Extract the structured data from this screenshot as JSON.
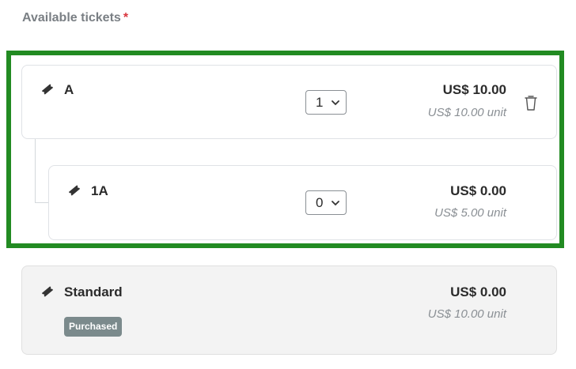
{
  "section": {
    "label": "Available tickets",
    "required_marker": "*"
  },
  "tickets": [
    {
      "name": "A",
      "quantity": "1",
      "price": "US$ 10.00",
      "unit_price": "US$ 10.00 unit",
      "icon": "ticket-icon",
      "removable": true
    },
    {
      "name": "1A",
      "quantity": "0",
      "price": "US$ 0.00",
      "unit_price": "US$ 5.00 unit",
      "icon": "ticket-icon",
      "child_of": "A"
    },
    {
      "name": "Standard",
      "badge": "Purchased",
      "price": "US$ 0.00",
      "unit_price": "US$ 10.00 unit",
      "icon": "ticket-icon"
    }
  ],
  "colors": {
    "highlight_border": "#228b22",
    "required": "#d9363e",
    "badge_bg": "#7b8a8c"
  }
}
